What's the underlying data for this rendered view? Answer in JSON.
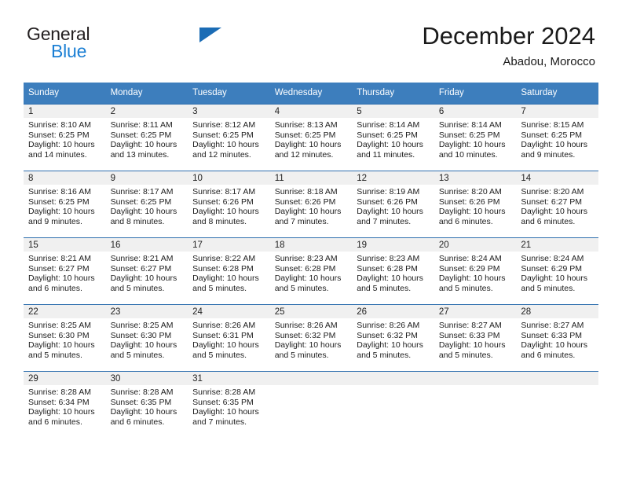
{
  "brand": {
    "name_part1": "General",
    "name_part2": "Blue",
    "triangle_color": "#1b6cb5",
    "blue_color": "#1b7fd4"
  },
  "header": {
    "title": "December 2024",
    "subtitle": "Abadou, Morocco"
  },
  "theme": {
    "header_row_bg": "#3d7ebd",
    "day_number_bg": "#f0f0f0",
    "week_divider": "#2f6fae"
  },
  "weekday_headers": [
    "Sunday",
    "Monday",
    "Tuesday",
    "Wednesday",
    "Thursday",
    "Friday",
    "Saturday"
  ],
  "weeks": [
    [
      {
        "day": "1",
        "sunrise": "Sunrise: 8:10 AM",
        "sunset": "Sunset: 6:25 PM",
        "daylight1": "Daylight: 10 hours",
        "daylight2": "and 14 minutes."
      },
      {
        "day": "2",
        "sunrise": "Sunrise: 8:11 AM",
        "sunset": "Sunset: 6:25 PM",
        "daylight1": "Daylight: 10 hours",
        "daylight2": "and 13 minutes."
      },
      {
        "day": "3",
        "sunrise": "Sunrise: 8:12 AM",
        "sunset": "Sunset: 6:25 PM",
        "daylight1": "Daylight: 10 hours",
        "daylight2": "and 12 minutes."
      },
      {
        "day": "4",
        "sunrise": "Sunrise: 8:13 AM",
        "sunset": "Sunset: 6:25 PM",
        "daylight1": "Daylight: 10 hours",
        "daylight2": "and 12 minutes."
      },
      {
        "day": "5",
        "sunrise": "Sunrise: 8:14 AM",
        "sunset": "Sunset: 6:25 PM",
        "daylight1": "Daylight: 10 hours",
        "daylight2": "and 11 minutes."
      },
      {
        "day": "6",
        "sunrise": "Sunrise: 8:14 AM",
        "sunset": "Sunset: 6:25 PM",
        "daylight1": "Daylight: 10 hours",
        "daylight2": "and 10 minutes."
      },
      {
        "day": "7",
        "sunrise": "Sunrise: 8:15 AM",
        "sunset": "Sunset: 6:25 PM",
        "daylight1": "Daylight: 10 hours",
        "daylight2": "and 9 minutes."
      }
    ],
    [
      {
        "day": "8",
        "sunrise": "Sunrise: 8:16 AM",
        "sunset": "Sunset: 6:25 PM",
        "daylight1": "Daylight: 10 hours",
        "daylight2": "and 9 minutes."
      },
      {
        "day": "9",
        "sunrise": "Sunrise: 8:17 AM",
        "sunset": "Sunset: 6:25 PM",
        "daylight1": "Daylight: 10 hours",
        "daylight2": "and 8 minutes."
      },
      {
        "day": "10",
        "sunrise": "Sunrise: 8:17 AM",
        "sunset": "Sunset: 6:26 PM",
        "daylight1": "Daylight: 10 hours",
        "daylight2": "and 8 minutes."
      },
      {
        "day": "11",
        "sunrise": "Sunrise: 8:18 AM",
        "sunset": "Sunset: 6:26 PM",
        "daylight1": "Daylight: 10 hours",
        "daylight2": "and 7 minutes."
      },
      {
        "day": "12",
        "sunrise": "Sunrise: 8:19 AM",
        "sunset": "Sunset: 6:26 PM",
        "daylight1": "Daylight: 10 hours",
        "daylight2": "and 7 minutes."
      },
      {
        "day": "13",
        "sunrise": "Sunrise: 8:20 AM",
        "sunset": "Sunset: 6:26 PM",
        "daylight1": "Daylight: 10 hours",
        "daylight2": "and 6 minutes."
      },
      {
        "day": "14",
        "sunrise": "Sunrise: 8:20 AM",
        "sunset": "Sunset: 6:27 PM",
        "daylight1": "Daylight: 10 hours",
        "daylight2": "and 6 minutes."
      }
    ],
    [
      {
        "day": "15",
        "sunrise": "Sunrise: 8:21 AM",
        "sunset": "Sunset: 6:27 PM",
        "daylight1": "Daylight: 10 hours",
        "daylight2": "and 6 minutes."
      },
      {
        "day": "16",
        "sunrise": "Sunrise: 8:21 AM",
        "sunset": "Sunset: 6:27 PM",
        "daylight1": "Daylight: 10 hours",
        "daylight2": "and 5 minutes."
      },
      {
        "day": "17",
        "sunrise": "Sunrise: 8:22 AM",
        "sunset": "Sunset: 6:28 PM",
        "daylight1": "Daylight: 10 hours",
        "daylight2": "and 5 minutes."
      },
      {
        "day": "18",
        "sunrise": "Sunrise: 8:23 AM",
        "sunset": "Sunset: 6:28 PM",
        "daylight1": "Daylight: 10 hours",
        "daylight2": "and 5 minutes."
      },
      {
        "day": "19",
        "sunrise": "Sunrise: 8:23 AM",
        "sunset": "Sunset: 6:28 PM",
        "daylight1": "Daylight: 10 hours",
        "daylight2": "and 5 minutes."
      },
      {
        "day": "20",
        "sunrise": "Sunrise: 8:24 AM",
        "sunset": "Sunset: 6:29 PM",
        "daylight1": "Daylight: 10 hours",
        "daylight2": "and 5 minutes."
      },
      {
        "day": "21",
        "sunrise": "Sunrise: 8:24 AM",
        "sunset": "Sunset: 6:29 PM",
        "daylight1": "Daylight: 10 hours",
        "daylight2": "and 5 minutes."
      }
    ],
    [
      {
        "day": "22",
        "sunrise": "Sunrise: 8:25 AM",
        "sunset": "Sunset: 6:30 PM",
        "daylight1": "Daylight: 10 hours",
        "daylight2": "and 5 minutes."
      },
      {
        "day": "23",
        "sunrise": "Sunrise: 8:25 AM",
        "sunset": "Sunset: 6:30 PM",
        "daylight1": "Daylight: 10 hours",
        "daylight2": "and 5 minutes."
      },
      {
        "day": "24",
        "sunrise": "Sunrise: 8:26 AM",
        "sunset": "Sunset: 6:31 PM",
        "daylight1": "Daylight: 10 hours",
        "daylight2": "and 5 minutes."
      },
      {
        "day": "25",
        "sunrise": "Sunrise: 8:26 AM",
        "sunset": "Sunset: 6:32 PM",
        "daylight1": "Daylight: 10 hours",
        "daylight2": "and 5 minutes."
      },
      {
        "day": "26",
        "sunrise": "Sunrise: 8:26 AM",
        "sunset": "Sunset: 6:32 PM",
        "daylight1": "Daylight: 10 hours",
        "daylight2": "and 5 minutes."
      },
      {
        "day": "27",
        "sunrise": "Sunrise: 8:27 AM",
        "sunset": "Sunset: 6:33 PM",
        "daylight1": "Daylight: 10 hours",
        "daylight2": "and 5 minutes."
      },
      {
        "day": "28",
        "sunrise": "Sunrise: 8:27 AM",
        "sunset": "Sunset: 6:33 PM",
        "daylight1": "Daylight: 10 hours",
        "daylight2": "and 6 minutes."
      }
    ],
    [
      {
        "day": "29",
        "sunrise": "Sunrise: 8:28 AM",
        "sunset": "Sunset: 6:34 PM",
        "daylight1": "Daylight: 10 hours",
        "daylight2": "and 6 minutes."
      },
      {
        "day": "30",
        "sunrise": "Sunrise: 8:28 AM",
        "sunset": "Sunset: 6:35 PM",
        "daylight1": "Daylight: 10 hours",
        "daylight2": "and 6 minutes."
      },
      {
        "day": "31",
        "sunrise": "Sunrise: 8:28 AM",
        "sunset": "Sunset: 6:35 PM",
        "daylight1": "Daylight: 10 hours",
        "daylight2": "and 7 minutes."
      },
      {
        "day": "",
        "sunrise": "",
        "sunset": "",
        "daylight1": "",
        "daylight2": ""
      },
      {
        "day": "",
        "sunrise": "",
        "sunset": "",
        "daylight1": "",
        "daylight2": ""
      },
      {
        "day": "",
        "sunrise": "",
        "sunset": "",
        "daylight1": "",
        "daylight2": ""
      },
      {
        "day": "",
        "sunrise": "",
        "sunset": "",
        "daylight1": "",
        "daylight2": ""
      }
    ]
  ]
}
